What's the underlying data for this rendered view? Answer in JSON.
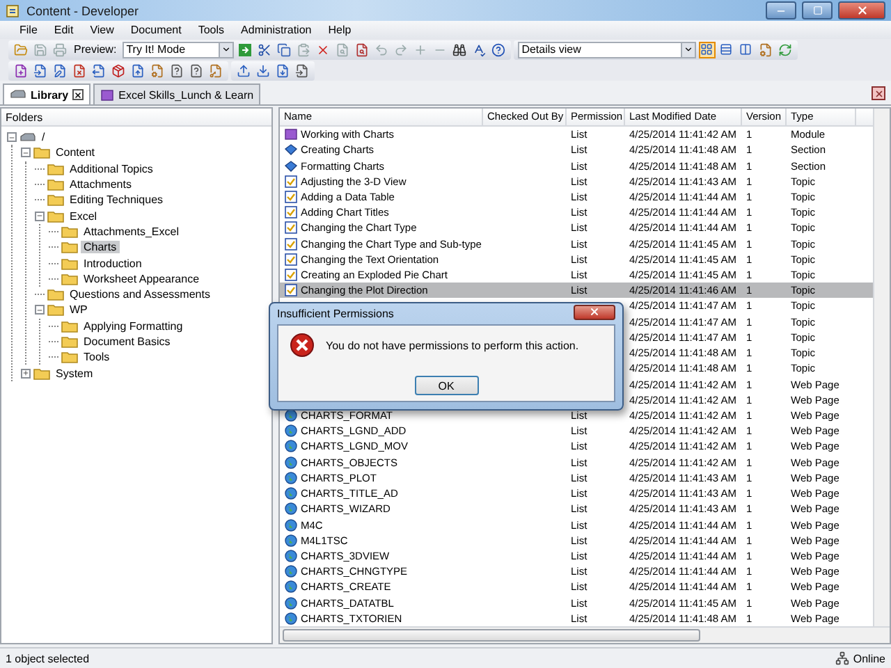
{
  "window": {
    "title": "Content - Developer"
  },
  "menu": [
    "File",
    "Edit",
    "View",
    "Document",
    "Tools",
    "Administration",
    "Help"
  ],
  "toolbar": {
    "preview_label": "Preview:",
    "preview_mode": "Try It! Mode",
    "view_mode": "Details view",
    "views": [
      {
        "selected": true
      },
      {
        "selected": false
      },
      {
        "selected": false
      }
    ]
  },
  "tabs": [
    {
      "label": "Library",
      "selected": true,
      "kind": "library"
    },
    {
      "label": "Excel Skills_Lunch & Learn",
      "selected": false,
      "kind": "package"
    }
  ],
  "folders": {
    "title": "Folders",
    "tree": [
      {
        "label": "/",
        "kind": "drive",
        "expanded": true,
        "selected": false,
        "children": [
          {
            "label": "Content",
            "kind": "folder",
            "expanded": true,
            "selected": false,
            "children": [
              {
                "label": "Additional Topics",
                "kind": "folder",
                "selected": false
              },
              {
                "label": "Attachments",
                "kind": "folder",
                "selected": false
              },
              {
                "label": "Editing Techniques",
                "kind": "folder",
                "selected": false
              },
              {
                "label": "Excel",
                "kind": "folder",
                "expanded": true,
                "selected": false,
                "children": [
                  {
                    "label": "Attachments_Excel",
                    "kind": "folder",
                    "selected": false
                  },
                  {
                    "label": "Charts",
                    "kind": "folder",
                    "selected": true
                  },
                  {
                    "label": "Introduction",
                    "kind": "folder",
                    "selected": false
                  },
                  {
                    "label": "Worksheet Appearance",
                    "kind": "folder",
                    "selected": false
                  }
                ]
              },
              {
                "label": "Questions and Assessments",
                "kind": "folder",
                "selected": false
              },
              {
                "label": "WP",
                "kind": "folder",
                "expanded": true,
                "selected": false,
                "children": [
                  {
                    "label": "Applying Formatting",
                    "kind": "folder",
                    "selected": false
                  },
                  {
                    "label": "Document Basics",
                    "kind": "folder",
                    "selected": false
                  },
                  {
                    "label": "Tools",
                    "kind": "folder",
                    "selected": false
                  }
                ]
              }
            ]
          },
          {
            "label": "System",
            "kind": "folder",
            "expanded": false,
            "selected": false
          }
        ]
      }
    ]
  },
  "table": {
    "columns": [
      "Name",
      "Checked Out By",
      "Permission",
      "Last Modified Date",
      "Version",
      "Type"
    ],
    "rows": [
      {
        "kind": "module",
        "name": "Working with Charts",
        "permission": "List",
        "modified": "4/25/2014 11:41:42 AM",
        "version": "1",
        "type": "Module",
        "selected": false
      },
      {
        "kind": "section",
        "name": "Creating Charts",
        "permission": "List",
        "modified": "4/25/2014 11:41:48 AM",
        "version": "1",
        "type": "Section",
        "selected": false
      },
      {
        "kind": "section",
        "name": "Formatting Charts",
        "permission": "List",
        "modified": "4/25/2014 11:41:48 AM",
        "version": "1",
        "type": "Section",
        "selected": false
      },
      {
        "kind": "topic",
        "name": "Adjusting the 3-D View",
        "permission": "List",
        "modified": "4/25/2014 11:41:43 AM",
        "version": "1",
        "type": "Topic",
        "selected": false
      },
      {
        "kind": "topic",
        "name": "Adding a Data Table",
        "permission": "List",
        "modified": "4/25/2014 11:41:44 AM",
        "version": "1",
        "type": "Topic",
        "selected": false
      },
      {
        "kind": "topic",
        "name": "Adding Chart Titles",
        "permission": "List",
        "modified": "4/25/2014 11:41:44 AM",
        "version": "1",
        "type": "Topic",
        "selected": false
      },
      {
        "kind": "topic",
        "name": "Changing the Chart Type",
        "permission": "List",
        "modified": "4/25/2014 11:41:44 AM",
        "version": "1",
        "type": "Topic",
        "selected": false
      },
      {
        "kind": "topic",
        "name": "Changing the Chart Type and Sub-type",
        "permission": "List",
        "modified": "4/25/2014 11:41:45 AM",
        "version": "1",
        "type": "Topic",
        "selected": false
      },
      {
        "kind": "topic",
        "name": "Changing the Text Orientation",
        "permission": "List",
        "modified": "4/25/2014 11:41:45 AM",
        "version": "1",
        "type": "Topic",
        "selected": false
      },
      {
        "kind": "topic",
        "name": "Creating an Exploded Pie Chart",
        "permission": "List",
        "modified": "4/25/2014 11:41:45 AM",
        "version": "1",
        "type": "Topic",
        "selected": false
      },
      {
        "kind": "topic",
        "name": "Changing the Plot Direction",
        "permission": "List",
        "modified": "4/25/2014 11:41:46 AM",
        "version": "1",
        "type": "Topic",
        "selected": true
      },
      {
        "modified": "4/25/2014 11:41:47 AM",
        "version": "1",
        "type": "Topic",
        "selected": false
      },
      {
        "modified": "4/25/2014 11:41:47 AM",
        "version": "1",
        "type": "Topic",
        "selected": false
      },
      {
        "modified": "4/25/2014 11:41:47 AM",
        "version": "1",
        "type": "Topic",
        "selected": false
      },
      {
        "modified": "4/25/2014 11:41:48 AM",
        "version": "1",
        "type": "Topic",
        "selected": false
      },
      {
        "modified": "4/25/2014 11:41:48 AM",
        "version": "1",
        "type": "Topic",
        "selected": false
      },
      {
        "modified": "4/25/2014 11:41:42 AM",
        "version": "1",
        "type": "Web Page",
        "selected": false
      },
      {
        "modified": "4/25/2014 11:41:42 AM",
        "version": "1",
        "type": "Web Page",
        "selected": false
      },
      {
        "kind": "webpage",
        "name": "CHARTS_FORMAT",
        "permission": "List",
        "modified": "4/25/2014 11:41:42 AM",
        "version": "1",
        "type": "Web Page",
        "selected": false
      },
      {
        "kind": "webpage",
        "name": "CHARTS_LGND_ADD",
        "permission": "List",
        "modified": "4/25/2014 11:41:42 AM",
        "version": "1",
        "type": "Web Page",
        "selected": false
      },
      {
        "kind": "webpage",
        "name": "CHARTS_LGND_MOV",
        "permission": "List",
        "modified": "4/25/2014 11:41:42 AM",
        "version": "1",
        "type": "Web Page",
        "selected": false
      },
      {
        "kind": "webpage",
        "name": "CHARTS_OBJECTS",
        "permission": "List",
        "modified": "4/25/2014 11:41:42 AM",
        "version": "1",
        "type": "Web Page",
        "selected": false
      },
      {
        "kind": "webpage",
        "name": "CHARTS_PLOT",
        "permission": "List",
        "modified": "4/25/2014 11:41:43 AM",
        "version": "1",
        "type": "Web Page",
        "selected": false
      },
      {
        "kind": "webpage",
        "name": "CHARTS_TITLE_AD",
        "permission": "List",
        "modified": "4/25/2014 11:41:43 AM",
        "version": "1",
        "type": "Web Page",
        "selected": false
      },
      {
        "kind": "webpage",
        "name": "CHARTS_WIZARD",
        "permission": "List",
        "modified": "4/25/2014 11:41:43 AM",
        "version": "1",
        "type": "Web Page",
        "selected": false
      },
      {
        "kind": "webpage",
        "name": "M4C",
        "permission": "List",
        "modified": "4/25/2014 11:41:44 AM",
        "version": "1",
        "type": "Web Page",
        "selected": false
      },
      {
        "kind": "webpage",
        "name": "M4L1TSC",
        "permission": "List",
        "modified": "4/25/2014 11:41:44 AM",
        "version": "1",
        "type": "Web Page",
        "selected": false
      },
      {
        "kind": "webpage",
        "name": "CHARTS_3DVIEW",
        "permission": "List",
        "modified": "4/25/2014 11:41:44 AM",
        "version": "1",
        "type": "Web Page",
        "selected": false
      },
      {
        "kind": "webpage",
        "name": "CHARTS_CHNGTYPE",
        "permission": "List",
        "modified": "4/25/2014 11:41:44 AM",
        "version": "1",
        "type": "Web Page",
        "selected": false
      },
      {
        "kind": "webpage",
        "name": "CHARTS_CREATE",
        "permission": "List",
        "modified": "4/25/2014 11:41:44 AM",
        "version": "1",
        "type": "Web Page",
        "selected": false
      },
      {
        "kind": "webpage",
        "name": "CHARTS_DATATBL",
        "permission": "List",
        "modified": "4/25/2014 11:41:45 AM",
        "version": "1",
        "type": "Web Page",
        "selected": false
      },
      {
        "kind": "webpage",
        "name": "CHARTS_TXTORIEN",
        "permission": "List",
        "modified": "4/25/2014 11:41:48 AM",
        "version": "1",
        "type": "Web Page",
        "selected": false
      }
    ]
  },
  "dialog": {
    "title": "Insufficient Permissions",
    "message": "You do not have permissions to perform this action.",
    "button": "OK"
  },
  "status_bar": {
    "text": "1 object selected",
    "connection": "Online"
  }
}
